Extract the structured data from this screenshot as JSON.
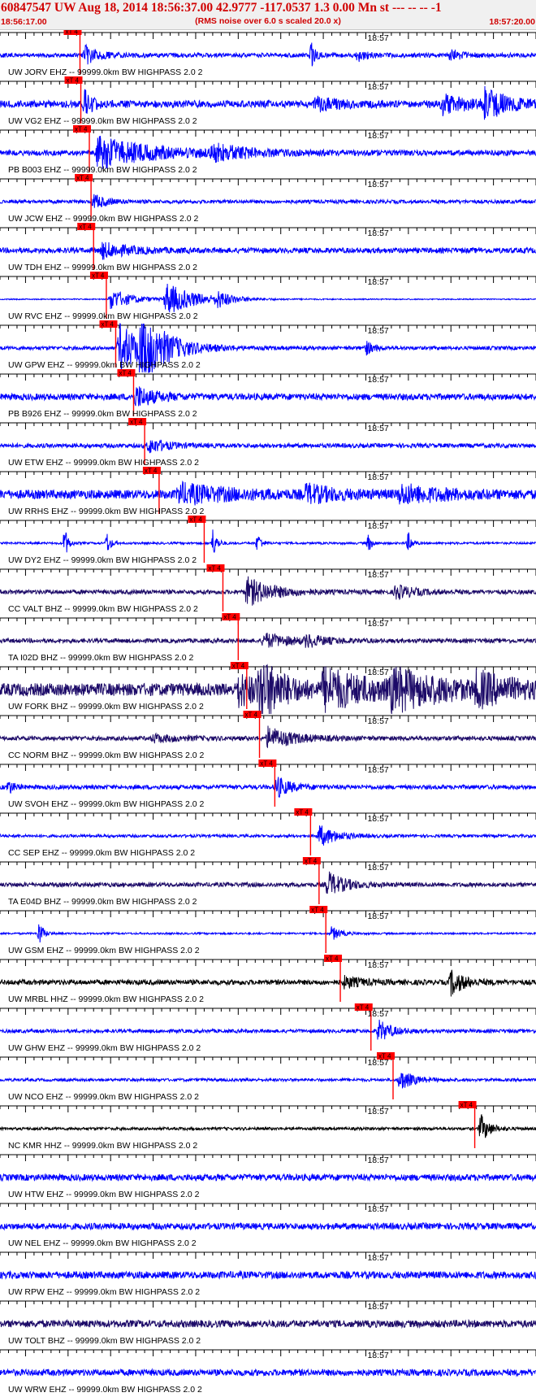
{
  "header": {
    "title": "60847547 UW Aug 18, 2014 18:56:37.00   42.9777 -117.0537  1.3 0.00 Mn st --- -- --   -1",
    "subtitle": "(RMS noise over 6.0 s scaled 20.0 x)",
    "start_time": "18:56:17.00",
    "end_time": "18:57:20.00"
  },
  "chart_data": {
    "type": "line",
    "title": "60847547 UW Aug 18, 2014 18:56:37.00   42.9777 -117.0537  1.3 0.00 Mn st --- -- --   -1",
    "subtitle": "(RMS noise over 6.0 s scaled 20.0 x)",
    "x_start": "18:56:17.00",
    "x_end": "18:57:20.00",
    "xlim": [
      0,
      63
    ],
    "x_unit": "seconds after 18:56:17.00",
    "grid": false,
    "legend": "none",
    "pick_label": "xT 4",
    "colors": {
      "blue": "#0000ff",
      "navy": "#1c0a68",
      "black": "#000000",
      "pick": "#ff0000"
    },
    "traces": [
      {
        "label": "UW JORV EHZ -- 99999.0km BW  HIGHPASS  2.0  2",
        "time_mark": "18:57",
        "pick_s": 9.4,
        "color": "blue",
        "noise": 0.12,
        "bursts": [
          {
            "t": 10,
            "a": 0.5,
            "w": 1.5
          },
          {
            "t": 36.6,
            "a": 0.7,
            "w": 0.5
          },
          {
            "t": 42,
            "a": 0.3,
            "w": 1.2
          },
          {
            "t": 53,
            "a": 0.35,
            "w": 1.2
          }
        ]
      },
      {
        "label": "UW VG2 EHZ -- 99999.0km BW  HIGHPASS  2.0  2",
        "time_mark": "18:57",
        "pick_s": 9.5,
        "color": "blue",
        "noise": 0.2,
        "bursts": [
          {
            "t": 10,
            "a": 0.7,
            "w": 0.8
          },
          {
            "t": 37,
            "a": 0.35,
            "w": 2.5
          },
          {
            "t": 52,
            "a": 0.5,
            "w": 3
          },
          {
            "t": 57,
            "a": 0.8,
            "w": 2.5
          }
        ]
      },
      {
        "label": "PB B003 EHZ -- 99999.0km BW  HIGHPASS  2.0  2",
        "time_mark": "18:57",
        "pick_s": 10.5,
        "color": "blue",
        "noise": 0.15,
        "bursts": [
          {
            "t": 11.5,
            "a": 0.9,
            "w": 6
          },
          {
            "t": 25,
            "a": 0.4,
            "w": 4
          }
        ]
      },
      {
        "label": "UW JCW EHZ -- 99999.0km BW  HIGHPASS  2.0  2",
        "time_mark": "18:57",
        "pick_s": 10.7,
        "color": "blue",
        "noise": 0.1,
        "bursts": [
          {
            "t": 11,
            "a": 0.4,
            "w": 1.5
          }
        ]
      },
      {
        "label": "UW TDH EHZ -- 99999.0km BW  HIGHPASS  2.0  2",
        "time_mark": "18:57",
        "pick_s": 11.0,
        "color": "blue",
        "noise": 0.15,
        "bursts": [
          {
            "t": 12,
            "a": 0.4,
            "w": 3
          }
        ]
      },
      {
        "label": "UW RVC EHZ -- 99999.0km BW  HIGHPASS  2.0  2",
        "time_mark": "18:57",
        "pick_s": 12.5,
        "color": "blue",
        "noise": 0.03,
        "bursts": [
          {
            "t": 13,
            "a": 0.6,
            "w": 2.5
          },
          {
            "t": 19.5,
            "a": 0.9,
            "w": 3.5
          },
          {
            "t": 25.5,
            "a": 0.4,
            "w": 1.5
          }
        ]
      },
      {
        "label": "UW GPW EHZ -- 99999.0km BW  HIGHPASS  2.0  2",
        "time_mark": "18:57",
        "pick_s": 13.6,
        "color": "blue",
        "noise": 0.1,
        "bursts": [
          {
            "t": 14,
            "a": 1.4,
            "w": 3
          },
          {
            "t": 16.5,
            "a": 1.6,
            "w": 3
          },
          {
            "t": 43,
            "a": 0.4,
            "w": 0.8
          }
        ]
      },
      {
        "label": "PB B926 EHZ -- 99999.0km BW  HIGHPASS  2.0  2",
        "time_mark": "18:57",
        "pick_s": 15.7,
        "color": "blue",
        "noise": 0.18,
        "bursts": [
          {
            "t": 16,
            "a": 0.6,
            "w": 2
          }
        ]
      },
      {
        "label": "UW ETW EHZ -- 99999.0km BW  HIGHPASS  2.0  2",
        "time_mark": "18:57",
        "pick_s": 17.0,
        "color": "blue",
        "noise": 0.12,
        "bursts": [
          {
            "t": 17.5,
            "a": 0.4,
            "w": 2
          }
        ]
      },
      {
        "label": "UW RRHS EHZ -- 99999.0km BW  HIGHPASS  2.0  2",
        "time_mark": "18:57",
        "pick_s": 18.7,
        "color": "blue",
        "noise": 0.25,
        "bursts": [
          {
            "t": 21,
            "a": 0.5,
            "w": 6
          },
          {
            "t": 36,
            "a": 0.45,
            "w": 3
          },
          {
            "t": 47,
            "a": 0.45,
            "w": 5
          }
        ]
      },
      {
        "label": "UW DY2 EHZ -- 99999.0km BW  HIGHPASS  2.0  2",
        "time_mark": "18:57",
        "pick_s": 24.0,
        "color": "blue",
        "noise": 0.06,
        "bursts": [
          {
            "t": 7.6,
            "a": 0.9,
            "w": 0.4
          },
          {
            "t": 12.6,
            "a": 0.6,
            "w": 0.4
          },
          {
            "t": 25,
            "a": 0.8,
            "w": 0.5
          },
          {
            "t": 30.3,
            "a": 0.6,
            "w": 0.4
          },
          {
            "t": 43.3,
            "a": 0.5,
            "w": 0.4
          },
          {
            "t": 48,
            "a": 0.6,
            "w": 0.4
          }
        ]
      },
      {
        "label": "CC VALT BHZ -- 99999.0km BW  HIGHPASS  2.0  2",
        "time_mark": "18:57",
        "pick_s": 26.2,
        "color": "navy",
        "noise": 0.12,
        "bursts": [
          {
            "t": 29,
            "a": 0.8,
            "w": 3
          },
          {
            "t": 46.5,
            "a": 0.4,
            "w": 2
          }
        ]
      },
      {
        "label": "TA I02D BHZ -- 99999.0km BW  HIGHPASS  2.0  2",
        "time_mark": "18:57",
        "pick_s": 28.0,
        "color": "navy",
        "noise": 0.12,
        "bursts": [
          {
            "t": 31,
            "a": 0.4,
            "w": 3
          },
          {
            "t": 36,
            "a": 0.3,
            "w": 2
          }
        ]
      },
      {
        "label": "UW FORK BHZ -- 99999.0km BW  HIGHPASS  2.0  2",
        "time_mark": "18:57",
        "pick_s": 29.0,
        "color": "navy",
        "noise": 0.35,
        "bursts": [
          {
            "t": 28,
            "a": 0.8,
            "w": 3
          },
          {
            "t": 30.5,
            "a": 1.6,
            "w": 2.5
          },
          {
            "t": 38,
            "a": 1,
            "w": 6
          },
          {
            "t": 46,
            "a": 0.9,
            "w": 6
          },
          {
            "t": 56,
            "a": 0.7,
            "w": 4
          }
        ]
      },
      {
        "label": "CC NORM BHZ -- 99999.0km BW  HIGHPASS  2.0  2",
        "time_mark": "18:57",
        "pick_s": 30.5,
        "color": "navy",
        "noise": 0.12,
        "bursts": [
          {
            "t": 31.5,
            "a": 0.6,
            "w": 3
          },
          {
            "t": 18,
            "a": 0.2,
            "w": 3
          }
        ]
      },
      {
        "label": "UW SVOH EHZ -- 99999.0km BW  HIGHPASS  2.0  2",
        "time_mark": "18:57",
        "pick_s": 32.3,
        "color": "blue",
        "noise": 0.12,
        "bursts": [
          {
            "t": 1,
            "a": 0.4,
            "w": 0.6
          },
          {
            "t": 32.5,
            "a": 0.6,
            "w": 1.5
          }
        ]
      },
      {
        "label": "CC SEP EHZ -- 99999.0km BW  HIGHPASS  2.0  2",
        "time_mark": "18:57",
        "pick_s": 36.5,
        "color": "blue",
        "noise": 0.08,
        "bursts": [
          {
            "t": 37.5,
            "a": 0.6,
            "w": 2
          }
        ]
      },
      {
        "label": "TA E04D BHZ -- 99999.0km BW  HIGHPASS  2.0  2",
        "time_mark": "18:57",
        "pick_s": 37.5,
        "color": "navy",
        "noise": 0.12,
        "bursts": [
          {
            "t": 38.5,
            "a": 0.7,
            "w": 2
          }
        ]
      },
      {
        "label": "UW GSM EHZ -- 99999.0km BW  HIGHPASS  2.0  2",
        "time_mark": "18:57",
        "pick_s": 38.3,
        "color": "blue",
        "noise": 0.05,
        "bursts": [
          {
            "t": 4.6,
            "a": 0.7,
            "w": 0.5
          },
          {
            "t": 39,
            "a": 0.4,
            "w": 1
          }
        ]
      },
      {
        "label": "UW MRBL HHZ -- 99999.0km BW  HIGHPASS  2.0  2",
        "time_mark": "18:57",
        "pick_s": 40.0,
        "color": "black",
        "noise": 0.14,
        "bursts": [
          {
            "t": 40.5,
            "a": 0.3,
            "w": 2
          },
          {
            "t": 53,
            "a": 0.7,
            "w": 1.5
          }
        ]
      },
      {
        "label": "UW GHW EHZ -- 99999.0km BW  HIGHPASS  2.0  2",
        "time_mark": "18:57",
        "pick_s": 43.6,
        "color": "blue",
        "noise": 0.1,
        "bursts": [
          {
            "t": 44.5,
            "a": 0.6,
            "w": 1.5
          }
        ]
      },
      {
        "label": "UW NCO EHZ -- 99999.0km BW  HIGHPASS  2.0  2",
        "time_mark": "18:57",
        "pick_s": 46.2,
        "color": "blue",
        "noise": 0.08,
        "bursts": [
          {
            "t": 47,
            "a": 0.6,
            "w": 1.5
          }
        ]
      },
      {
        "label": "NC KMR HHZ -- 99999.0km BW  HIGHPASS  2.0  2",
        "time_mark": "18:57",
        "pick_s": 55.8,
        "color": "black",
        "noise": 0.08,
        "bursts": [
          {
            "t": 56.5,
            "a": 0.8,
            "w": 1
          }
        ]
      },
      {
        "label": "UW HTW EHZ -- 99999.0km BW  HIGHPASS  2.0  2",
        "time_mark": "18:57",
        "color": "blue",
        "noise": 0.18,
        "bursts": []
      },
      {
        "label": "UW NEL EHZ -- 99999.0km BW  HIGHPASS  2.0  2",
        "time_mark": "18:57",
        "color": "blue",
        "noise": 0.18,
        "bursts": []
      },
      {
        "label": "UW RPW EHZ -- 99999.0km BW  HIGHPASS  2.0  2",
        "time_mark": "18:57",
        "color": "blue",
        "noise": 0.2,
        "bursts": []
      },
      {
        "label": "UW TOLT BHZ -- 99999.0km BW  HIGHPASS  2.0  2",
        "time_mark": "18:57",
        "color": "navy",
        "noise": 0.2,
        "bursts": []
      },
      {
        "label": "UW WRW EHZ -- 99999.0km BW  HIGHPASS  2.0  2",
        "time_mark": "18:57",
        "color": "blue",
        "noise": 0.18,
        "bursts": []
      }
    ]
  }
}
